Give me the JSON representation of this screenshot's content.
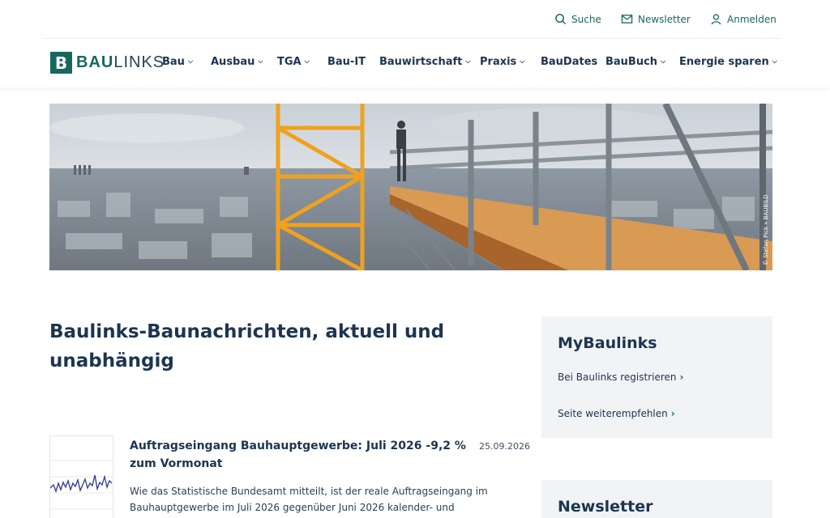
{
  "utility": {
    "search": "Suche",
    "newsletter": "Newsletter",
    "login": "Anmelden"
  },
  "logo": {
    "mark": "B",
    "part1": "BAU",
    "part2": "LINKS"
  },
  "nav": [
    {
      "label": "Bau",
      "has_menu": true
    },
    {
      "label": "Ausbau",
      "has_menu": true
    },
    {
      "label": "TGA",
      "has_menu": true
    },
    {
      "label": "Bau-IT",
      "has_menu": false
    },
    {
      "label": "Bauwirtschaft",
      "has_menu": true
    },
    {
      "label": "Praxis",
      "has_menu": true
    },
    {
      "label": "BauDates",
      "has_menu": false
    },
    {
      "label": "BauBuch",
      "has_menu": true
    },
    {
      "label": "Energie sparen",
      "has_menu": true
    }
  ],
  "hero": {
    "credit": "© Stefan Pick » BAUBILD"
  },
  "main": {
    "heading": "Baulinks-Baunachrichten, aktuell und unabhängig"
  },
  "article": {
    "title": "Auftragseingang Bauhauptgewerbe: Juli 2026 -9,2 % zum Vormonat",
    "date": "25.09.2026",
    "text": "Wie das Statistische Bundesamt mitteilt, ist der reale Auftragseingang im Bauhauptgewerbe im Juli 2026 gegenüber Juni 2026 kalender- und"
  },
  "sidebar": {
    "mybaulinks": {
      "title": "MyBaulinks",
      "register": "Bei Baulinks registrieren",
      "recommend": "Seite weiterempfehlen"
    },
    "newsletter": {
      "title": "Newsletter"
    }
  },
  "colors": {
    "accent": "#17675f",
    "text": "#1c3550",
    "panel": "#f1f3f5"
  }
}
